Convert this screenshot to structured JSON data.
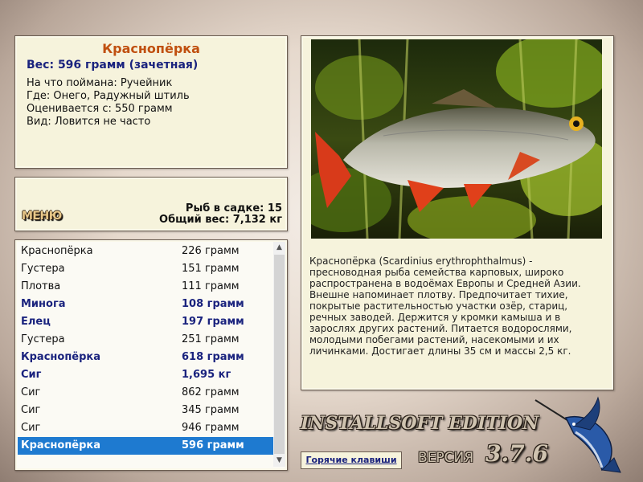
{
  "fish_info": {
    "name": "Краснопёрка",
    "weight_line": "Вес: 596 грамм (зачетная)",
    "bait": "На что поймана: Ручейник",
    "location": "Где: Онего, Радужный штиль",
    "rated_from": "Оценивается с: 550 грамм",
    "kind": "Вид: Ловится не часто"
  },
  "menu_label": "МЕНЮ",
  "summary": {
    "fish_count": "Рыб в садке: 15",
    "total_weight": "Общий вес: 7,132 кг"
  },
  "catch_list": [
    {
      "name": "Краснопёрка",
      "weight": "226 грамм"
    },
    {
      "name": "Густера",
      "weight": "151 грамм"
    },
    {
      "name": "Плотва",
      "weight": "111 грамм"
    },
    {
      "name": "Минога",
      "weight": "108 грамм"
    },
    {
      "name": "Елец",
      "weight": "197 грамм"
    },
    {
      "name": "Густера",
      "weight": "251 грамм"
    },
    {
      "name": "Краснопёрка",
      "weight": "618 грамм"
    },
    {
      "name": "Сиг",
      "weight": "1,695 кг"
    },
    {
      "name": "Сиг",
      "weight": "862 грамм"
    },
    {
      "name": "Сиг",
      "weight": "345 грамм"
    },
    {
      "name": "Сиг",
      "weight": "946 грамм"
    },
    {
      "name": "Краснопёрка",
      "weight": "596 грамм"
    }
  ],
  "description_lines": [
    "Краснопёрка (Scardinius erythrophthalmus) -",
    "пресноводная рыба семейства карповых, широко",
    "распространена в водоёмах Европы и Средней Азии.",
    "Внешне напоминает плотву. Предпочитает тихие,",
    "покрытые растительностью участки озёр, стариц,",
    "речных заводей. Держится у кромки камыша и в",
    "зарослях других растений. Питается водорослями,",
    "молодыми побегами растений, насекомыми и их",
    "личинками. Достигает длины 35 см и массы 2,5 кг."
  ],
  "branding": {
    "edition": "INSTALLSOFT EDITION",
    "version_label": "ВЕРСИЯ",
    "version_number": "3.7.6"
  },
  "hotkeys_label": "Горячие клавиши",
  "colors": {
    "accent_title": "#c05010",
    "highlight_text": "#1a237e",
    "selection": "#1e7ad0"
  },
  "icons": [
    "scroll-up-arrow-icon",
    "scroll-down-arrow-icon",
    "marlin-logo-icon"
  ]
}
